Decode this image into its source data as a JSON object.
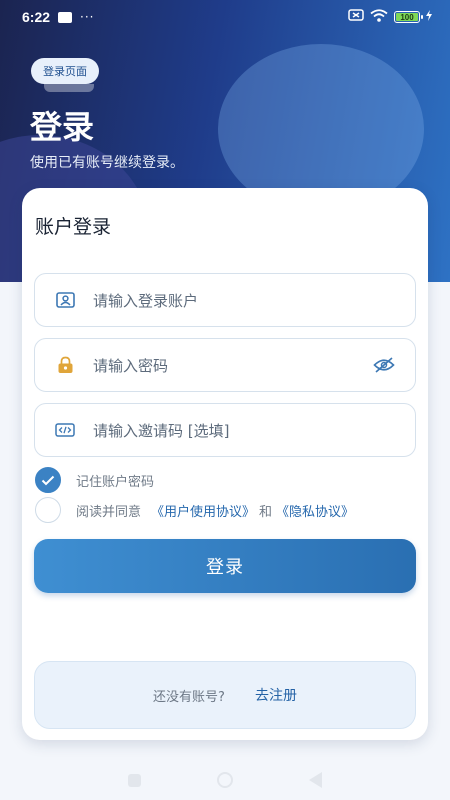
{
  "status_bar": {
    "time": "6:22",
    "dots": "···",
    "battery": "100"
  },
  "hero": {
    "tag": "登录页面",
    "title": "登录",
    "subtitle": "使用已有账号继续登录。"
  },
  "form": {
    "title": "账户登录",
    "account_placeholder": "请输入登录账户",
    "password_placeholder": "请输入密码",
    "invite_placeholder": "请输入邀请码 [选填]",
    "remember_label": "记住账户密码",
    "remember_checked": true,
    "agree_prefix": "阅读并同意",
    "user_agreement": "《用户使用协议》",
    "agree_and": "和",
    "privacy_agreement": "《隐私协议》",
    "agree_checked": false,
    "login_button": "登录"
  },
  "register": {
    "hint": "还没有账号?",
    "link": "去注册"
  },
  "colors": {
    "accent": "#2f78bd",
    "hero_dark": "#1b2450",
    "hero_light": "#2e72c4",
    "password_icon": "#e0a53a"
  },
  "icons": {
    "account": "id-card-icon",
    "password": "lock-icon",
    "invite": "code-icon",
    "visibility": "eye-off-icon"
  }
}
